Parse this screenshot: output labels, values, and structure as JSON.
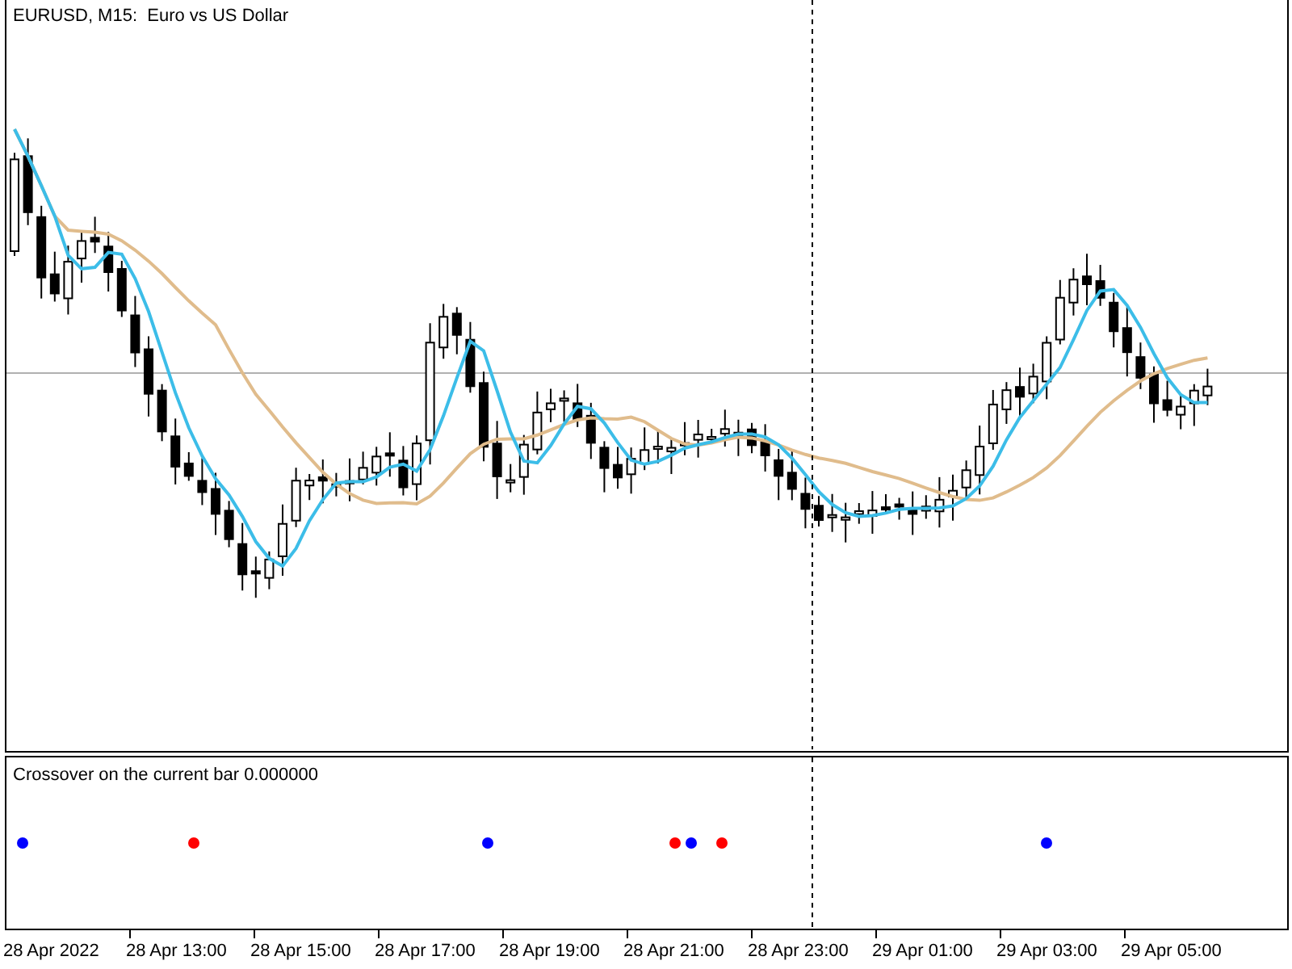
{
  "chart_title": "EURUSD, M15:  Euro vs US Dollar",
  "indicator_label": "Crossover on the current bar 0.000000",
  "time_axis": [
    "28 Apr 2022",
    "28 Apr 13:00",
    "28 Apr 15:00",
    "28 Apr 17:00",
    "28 Apr 19:00",
    "28 Apr 21:00",
    "28 Apr 23:00",
    "29 Apr 01:00",
    "29 Apr 03:00",
    "29 Apr 05:00"
  ]
}
